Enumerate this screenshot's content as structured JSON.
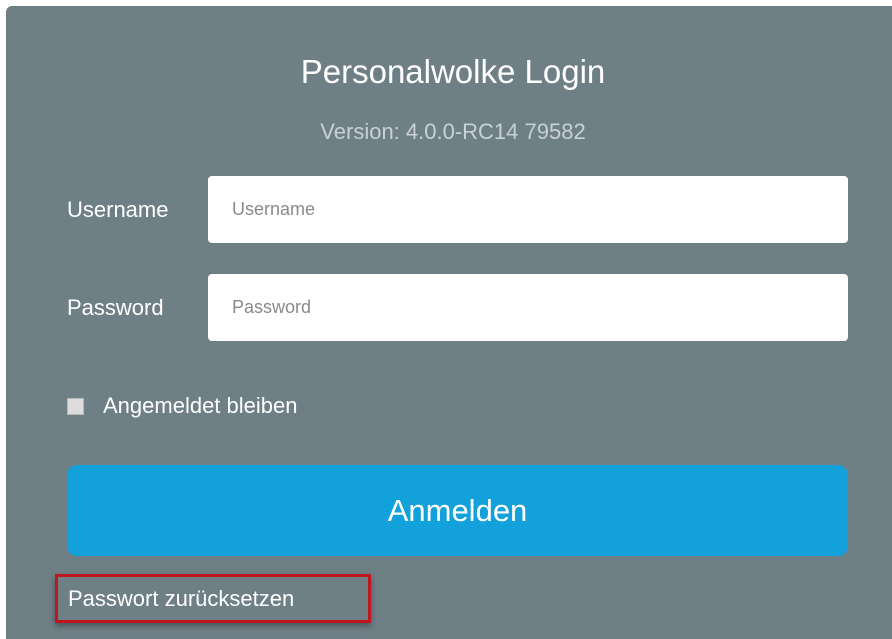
{
  "login": {
    "title": "Personalwolke Login",
    "version": "Version: 4.0.0-RC14 79582",
    "username_label": "Username",
    "username_placeholder": "Username",
    "username_value": "",
    "password_label": "Password",
    "password_placeholder": "Password",
    "password_value": "",
    "remember_label": "Angemeldet bleiben",
    "remember_checked": false,
    "submit_label": "Anmelden",
    "reset_link": "Passwort zurücksetzen"
  },
  "colors": {
    "panel_background": "#6f7f86",
    "button_background": "#12a1da",
    "highlight_border": "#c0161d"
  }
}
